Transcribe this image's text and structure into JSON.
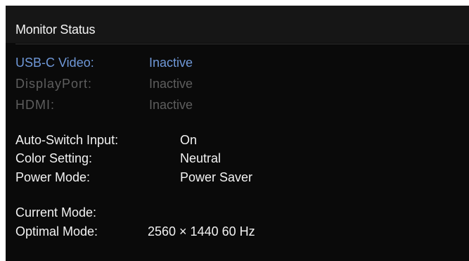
{
  "panel": {
    "title": "Monitor Status"
  },
  "inputs": [
    {
      "label": "USB-C Video:",
      "value": "Inactive",
      "state": "active-selected"
    },
    {
      "label": "DisplayPort:",
      "value": "Inactive",
      "state": "dimmed"
    },
    {
      "label": "HDMI:",
      "value": "Inactive",
      "state": "dimmed"
    }
  ],
  "settings": [
    {
      "label": "Auto-Switch Input:",
      "value": "On"
    },
    {
      "label": "Color Setting:",
      "value": "Neutral"
    },
    {
      "label": "Power Mode:",
      "value": "Power Saver"
    }
  ],
  "modes": [
    {
      "label": "Current Mode:",
      "value": ""
    },
    {
      "label": "Optimal Mode:",
      "value": "2560 × 1440  60 Hz"
    }
  ],
  "colors": {
    "background": "#0a0a0a",
    "header": "#161616",
    "highlight": "#6f98d8",
    "dimmed": "#5e5e5e",
    "text": "#f2f2f2"
  }
}
